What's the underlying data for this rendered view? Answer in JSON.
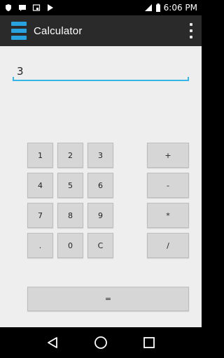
{
  "status_bar": {
    "time": "6:06 PM",
    "icons": [
      "shield-icon",
      "message-icon",
      "cast-icon",
      "play-store-icon",
      "signal-icon",
      "battery-icon"
    ]
  },
  "app_bar": {
    "title": "Calculator",
    "menu_icon": "menu-icon",
    "overflow_icon": "overflow-menu-icon",
    "accent_color": "#29a3df"
  },
  "display": {
    "value": "3",
    "placeholder": ""
  },
  "keypad": {
    "digits": [
      [
        "1",
        "2",
        "3"
      ],
      [
        "4",
        "5",
        "6"
      ],
      [
        "7",
        "8",
        "9"
      ],
      [
        ".",
        "0",
        "C"
      ]
    ],
    "operators": [
      "+",
      "-",
      "*",
      "/"
    ],
    "equals": "="
  },
  "navigation": {
    "icons": [
      "back-icon",
      "home-icon",
      "recents-icon"
    ]
  }
}
